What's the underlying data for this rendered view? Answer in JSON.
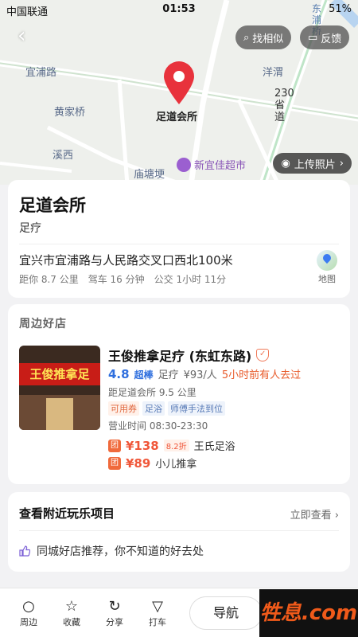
{
  "status_bar": {
    "carrier": "中国联通",
    "time": "01:53",
    "battery": "51%"
  },
  "map": {
    "labels": {
      "yipu_road": "宜浦路",
      "huangjiaqiao": "黄家桥",
      "xixi": "溪西",
      "yangwei": "洋渭",
      "miaotangjing": "庙塘埂",
      "road_230": "230省道",
      "supermarket": "新宜佳超市",
      "bridge": "东浦桥"
    },
    "pin_label": "足道会所",
    "find_similar": "找相似",
    "feedback": "反馈",
    "upload_photo": "上传照片"
  },
  "place": {
    "name": "足道会所",
    "category": "足疗",
    "address": "宜兴市宜浦路与人民路交叉口西北100米",
    "distance": "距你 8.7 公里",
    "drive": "驾车 16 分钟",
    "bus": "公交 1小时 11分",
    "map_label": "地图"
  },
  "recommend": {
    "header": "周边好店",
    "shop": {
      "name": "王俊推拿足疗 (东虹东路)",
      "score": "4.8",
      "score_tag": "超棒",
      "category": "足疗",
      "price": "¥93/人",
      "recent": "5小时前有人去过",
      "distance": "距足道会所 9.5 公里",
      "tags": [
        "可用券",
        "足浴",
        "师傅手法到位"
      ],
      "hours": "营业时间 08:30-23:30",
      "image_sign": "王俊推拿足",
      "deals": [
        {
          "badge": "团",
          "price": "¥138",
          "discount": "8.2折",
          "name": "王氏足浴"
        },
        {
          "badge": "团",
          "price": "¥89",
          "discount": "",
          "name": "小儿推拿"
        }
      ]
    }
  },
  "nearby": {
    "title": "查看附近玩乐项目",
    "link": "立即查看",
    "row": "同城好店推荐，你不知道的好去处"
  },
  "bottom_bar": {
    "items": [
      "周边",
      "收藏",
      "分享",
      "打车"
    ],
    "nav": "导航"
  },
  "watermark": "牲息.com",
  "colors": {
    "pin": "#e8323c",
    "accent": "#2f6fde",
    "price": "#f0573a"
  }
}
